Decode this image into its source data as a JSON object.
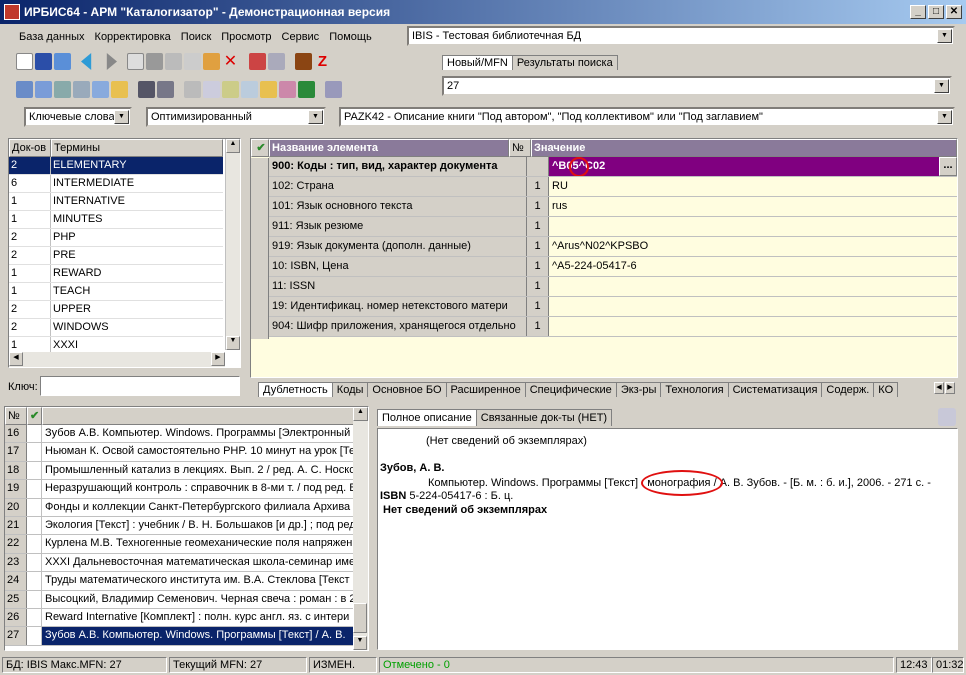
{
  "window": {
    "title": "ИРБИС64 - АРМ \"Каталогизатор\" - Демонстрационная версия"
  },
  "menu": [
    "База данных",
    "Корректировка",
    "Поиск",
    "Просмотр",
    "Сервис",
    "Помощь"
  ],
  "db_select": "IBIS - Тестовая библиотечная БД",
  "right_tabs": [
    "Новый/MFN",
    "Результаты поиска"
  ],
  "mfn_value": "27",
  "dict_combo": "Ключевые слова",
  "opt_combo": "Оптимизированный",
  "worksheet_combo": "PAZK42 - Описание книги \"Под автором\", \"Под коллективом\" или \"Под заглавием\"",
  "terms": {
    "headers": [
      "Док-ов",
      "Термины"
    ],
    "rows": [
      [
        "2",
        "ELEMENTARY"
      ],
      [
        "6",
        "INTERMEDIATE"
      ],
      [
        "1",
        "INTERNATIVE"
      ],
      [
        "1",
        "MINUTES"
      ],
      [
        "2",
        "PHP"
      ],
      [
        "2",
        "PRE"
      ],
      [
        "1",
        "REWARD"
      ],
      [
        "1",
        "TEACH"
      ],
      [
        "2",
        "UPPER"
      ],
      [
        "2",
        "WINDOWS"
      ],
      [
        "1",
        "XXXI"
      ]
    ],
    "key_label": "Ключ:"
  },
  "fields": {
    "headers": [
      "Название элемента",
      "№",
      "Значение"
    ],
    "rows": [
      {
        "name": "900: Коды : тип, вид, характер документа",
        "num": "",
        "value": "^B05^C02"
      },
      {
        "name": "102: Страна",
        "num": "1",
        "value": "RU"
      },
      {
        "name": "101: Язык основного текста",
        "num": "1",
        "value": "rus"
      },
      {
        "name": "911: Язык резюме",
        "num": "1",
        "value": ""
      },
      {
        "name": "919: Язык документа (дополн. данные)",
        "num": "1",
        "value": "^Arus^N02^KPSBO"
      },
      {
        "name": "10: ISBN, Цена",
        "num": "1",
        "value": "^A5-224-05417-6"
      },
      {
        "name": "11: ISSN",
        "num": "1",
        "value": ""
      },
      {
        "name": "19: Идентификац. номер нетекстового матери",
        "num": "1",
        "value": ""
      },
      {
        "name": "904: Шифр приложения, хранящегося отдельно",
        "num": "1",
        "value": ""
      }
    ],
    "ellipsis": "...",
    "tabs": [
      "Дублетность",
      "Коды",
      "Основное БО",
      "Расширенное",
      "Специфические",
      "Экз-ры",
      "Технология",
      "Систематизация",
      "Содерж.",
      "КО"
    ]
  },
  "records": {
    "headers": [
      "№"
    ],
    "rows": [
      [
        "16",
        "Зубов А.В. Компьютер. Windows. Программы [Электронный"
      ],
      [
        "17",
        "Ньюман К. Освой самостоятельно PHP. 10 минут на урок [Те"
      ],
      [
        "18",
        "Промышленный катализ в лекциях. Вып. 2 / ред. А. С. Носко"
      ],
      [
        "19",
        "Неразрушающий контроль : справочник в 8-ми т. / под ред. В"
      ],
      [
        "20",
        "Фонды и коллекции Санкт-Петербургского филиала Архива Р"
      ],
      [
        "21",
        "Экология [Текст] : учебник / В. Н. Большаков [и др.] ; под ред"
      ],
      [
        "22",
        "Курлена М.В. Техногенные геомеханические поля напряжен"
      ],
      [
        "23",
        "XXXI Дальневосточная математическая школа-семинар име"
      ],
      [
        "24",
        "Труды математического института им. В.А. Стеклова [Текст"
      ],
      [
        "25",
        "Высоцкий, Владимир Семенович. Черная свеча : роман : в 2"
      ],
      [
        "26",
        "Reward Internative [Комплект] : полн. курс англ. яз. с интери"
      ],
      [
        "27",
        "Зубов А.В. Компьютер. Windows. Программы [Текст] / А. В."
      ]
    ]
  },
  "description": {
    "tabs": [
      "Полное описание",
      "Связанные док-ты (НЕТ)"
    ],
    "line1": "(Нет сведений об экземплярах)",
    "author": "Зубов, А. В.",
    "text_a": "Компьютер. Windows. Программы [Текст] : ",
    "text_b": "монография",
    "text_c": " / А. В. Зубов. - [Б. м. : б. и.], 2006. - 271 с. -",
    "isbn_label": "ISBN",
    "isbn_text": " 5-224-05417-6 : Б. ц.",
    "noinfo": "Нет сведений об экземплярах"
  },
  "status": {
    "db": "БД: IBIS Макс.MFN: 27",
    "cur": "Текущий MFN: 27",
    "mod": "ИЗМЕН.",
    "marked": "Отмечено - 0",
    "time": "12:43",
    "time2": "01:32"
  }
}
